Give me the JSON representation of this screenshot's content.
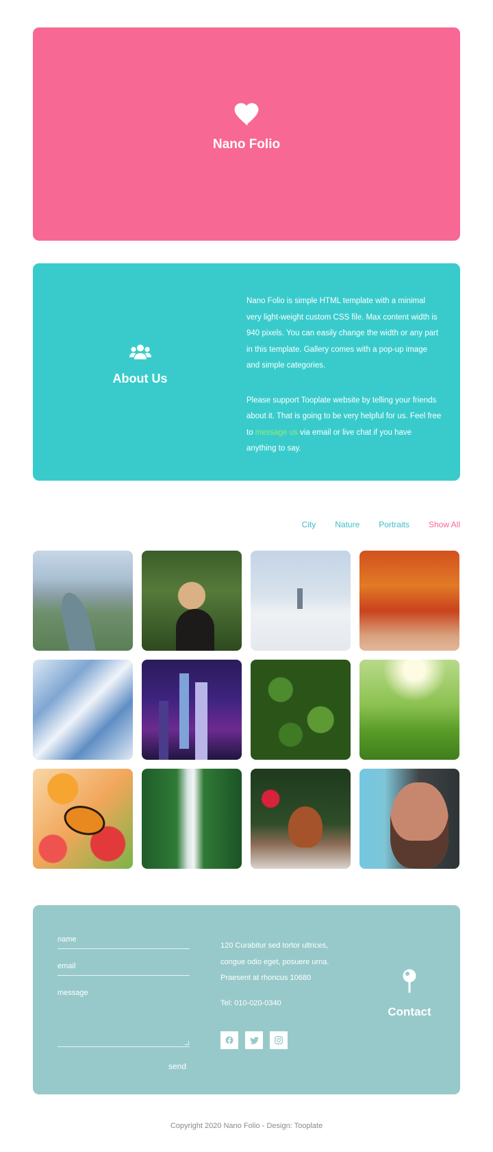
{
  "hero": {
    "title": "Nano Folio",
    "icon": "heart-icon",
    "color": "#f76895"
  },
  "about": {
    "title": "About Us",
    "icon": "users-icon",
    "color": "#39cbcc",
    "p1": "Nano Folio is simple HTML template with a minimal very light-weight custom CSS file. Max content width is 940 pixels. You can easily change the width or any part in this template. Gallery comes with a pop-up image and simple categories.",
    "p2_before": "Please support Tooplate website by telling your friends about it. That is going to be very helpful for us. Feel free to ",
    "p2_link": "message us",
    "p2_after": " via email or live chat if you have anything to say."
  },
  "filters": [
    {
      "label": "City",
      "active": false
    },
    {
      "label": "Nature",
      "active": false
    },
    {
      "label": "Portraits",
      "active": false
    },
    {
      "label": "Show All",
      "active": true
    }
  ],
  "gallery": [
    {
      "name": "city-aerial-river"
    },
    {
      "name": "portrait-woman-forest"
    },
    {
      "name": "city-above-clouds"
    },
    {
      "name": "nature-autumn-path"
    },
    {
      "name": "city-glass-skyscrapers"
    },
    {
      "name": "city-night-skyline"
    },
    {
      "name": "nature-tree-canopy"
    },
    {
      "name": "nature-sunlit-meadow"
    },
    {
      "name": "nature-butterfly-flowers"
    },
    {
      "name": "nature-waterfall-bridge"
    },
    {
      "name": "nature-squirrel"
    },
    {
      "name": "portrait-man-sunglasses"
    }
  ],
  "contact": {
    "title": "Contact",
    "icon": "map-pin-icon",
    "color": "#97c9ca",
    "form": {
      "name_placeholder": "name",
      "email_placeholder": "email",
      "message_placeholder": "message",
      "send_label": "send"
    },
    "address_line1": "120 Curabitur sed tortor ultrices,",
    "address_line2": "congue odio eget, posuere urna.",
    "address_line3": "Praesent at rhoncus 10680",
    "tel": "Tel: 010-020-0340",
    "socials": [
      "facebook-icon",
      "twitter-icon",
      "instagram-icon"
    ]
  },
  "footer": {
    "copyright": "Copyright 2020 Nano Folio - Design: Tooplate"
  }
}
